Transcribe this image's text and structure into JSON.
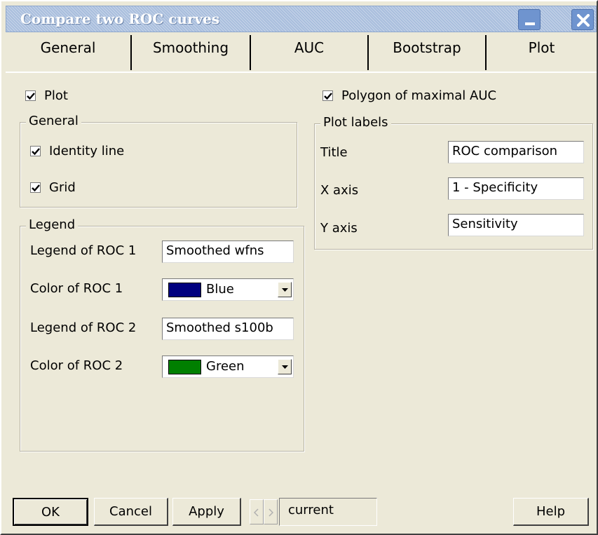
{
  "window": {
    "title": "Compare two ROC curves"
  },
  "tabs": [
    {
      "label": "General"
    },
    {
      "label": "Smoothing"
    },
    {
      "label": "AUC"
    },
    {
      "label": "Bootstrap"
    },
    {
      "label": "Plot",
      "active": true
    }
  ],
  "plot_checkbox": {
    "label": "Plot",
    "checked": true
  },
  "polygon_checkbox": {
    "label": "Polygon of maximal AUC",
    "checked": true
  },
  "general_group": {
    "title": "General",
    "identity_line": {
      "label": "Identity line",
      "checked": true
    },
    "grid": {
      "label": "Grid",
      "checked": true
    }
  },
  "legend_group": {
    "title": "Legend",
    "legend_roc1": {
      "label": "Legend of ROC 1",
      "value": "Smoothed wfns"
    },
    "color_roc1": {
      "label": "Color of ROC 1",
      "value": "Blue",
      "color": "#00007f"
    },
    "legend_roc2": {
      "label": "Legend of ROC 2",
      "value": "Smoothed s100b"
    },
    "color_roc2": {
      "label": "Color of ROC 2",
      "value": "Green",
      "color": "#007f00"
    }
  },
  "plot_labels_group": {
    "title": "Plot labels",
    "title_field": {
      "label": "Title",
      "value": "ROC comparison"
    },
    "x_axis": {
      "label": "X axis",
      "value": "1 - Specificity"
    },
    "y_axis": {
      "label": "Y axis",
      "value": "Sensitivity"
    }
  },
  "footer": {
    "ok": "OK",
    "cancel": "Cancel",
    "apply": "Apply",
    "current": "current",
    "help": "Help"
  },
  "colors": {
    "window_bg": "#ece9d8",
    "titlebar": "#a9bedd",
    "titlebar_button": "#6f94cf"
  }
}
